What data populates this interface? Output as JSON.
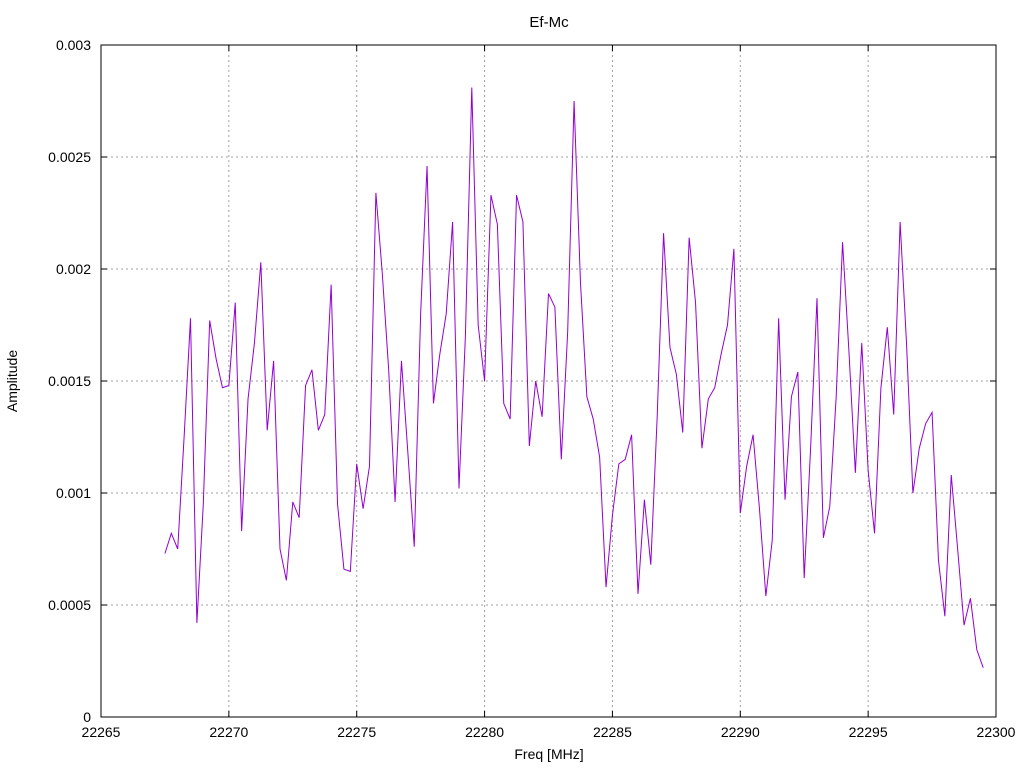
{
  "chart_data": {
    "type": "line",
    "title": "Ef-Mc",
    "xlabel": "Freq [MHz]",
    "ylabel": "Amplitude",
    "xlim": [
      22265,
      22300
    ],
    "ylim": [
      0,
      0.003
    ],
    "xticks": [
      22265,
      22270,
      22275,
      22280,
      22285,
      22290,
      22295,
      22300
    ],
    "yticks": [
      0,
      0.0005,
      0.001,
      0.0015,
      0.002,
      0.0025,
      0.003
    ],
    "ytick_labels": [
      "0",
      "0.0005",
      "0.001",
      "0.0015",
      "0.002",
      "0.0025",
      "0.003"
    ],
    "grid": true,
    "legend": "none",
    "series_color": "#9400d3",
    "x": [
      22267.5,
      22267.75,
      22268.0,
      22268.25,
      22268.5,
      22268.75,
      22269.0,
      22269.25,
      22269.5,
      22269.75,
      22270.0,
      22270.25,
      22270.5,
      22270.75,
      22271.0,
      22271.25,
      22271.5,
      22271.75,
      22272.0,
      22272.25,
      22272.5,
      22272.75,
      22273.0,
      22273.25,
      22273.5,
      22273.75,
      22274.0,
      22274.25,
      22274.5,
      22274.75,
      22275.0,
      22275.25,
      22275.5,
      22275.75,
      22276.0,
      22276.25,
      22276.5,
      22276.75,
      22277.0,
      22277.25,
      22277.5,
      22277.75,
      22278.0,
      22278.25,
      22278.5,
      22278.75,
      22279.0,
      22279.25,
      22279.5,
      22279.75,
      22280.0,
      22280.25,
      22280.5,
      22280.75,
      22281.0,
      22281.25,
      22281.5,
      22281.75,
      22282.0,
      22282.25,
      22282.5,
      22282.75,
      22283.0,
      22283.25,
      22283.5,
      22283.75,
      22284.0,
      22284.25,
      22284.5,
      22284.75,
      22285.0,
      22285.25,
      22285.5,
      22285.75,
      22286.0,
      22286.25,
      22286.5,
      22286.75,
      22287.0,
      22287.25,
      22287.5,
      22287.75,
      22288.0,
      22288.25,
      22288.5,
      22288.75,
      22289.0,
      22289.25,
      22289.5,
      22289.75,
      22290.0,
      22290.25,
      22290.5,
      22290.75,
      22291.0,
      22291.25,
      22291.5,
      22291.75,
      22292.0,
      22292.25,
      22292.5,
      22292.75,
      22293.0,
      22293.25,
      22293.5,
      22293.75,
      22294.0,
      22294.25,
      22294.5,
      22294.75,
      22295.0,
      22295.25,
      22295.5,
      22295.75,
      22296.0,
      22296.25,
      22296.5,
      22296.75,
      22297.0,
      22297.25,
      22297.5,
      22297.75,
      22298.0,
      22298.25,
      22298.5,
      22298.75,
      22299.0,
      22299.25,
      22299.5
    ],
    "y": [
      0.00073,
      0.00082,
      0.00075,
      0.00125,
      0.00178,
      0.00042,
      0.00095,
      0.00177,
      0.0016,
      0.00147,
      0.00148,
      0.00185,
      0.00083,
      0.00142,
      0.00167,
      0.00203,
      0.00128,
      0.00159,
      0.00075,
      0.00061,
      0.00096,
      0.00089,
      0.00148,
      0.00155,
      0.00128,
      0.00135,
      0.00193,
      0.00095,
      0.00066,
      0.00065,
      0.00113,
      0.00093,
      0.00112,
      0.00234,
      0.00198,
      0.00155,
      0.00096,
      0.00159,
      0.00118,
      0.00076,
      0.0018,
      0.00246,
      0.0014,
      0.00162,
      0.0018,
      0.00221,
      0.00102,
      0.0017,
      0.00281,
      0.00175,
      0.0015,
      0.00233,
      0.0022,
      0.0014,
      0.00133,
      0.00233,
      0.00221,
      0.00121,
      0.0015,
      0.00134,
      0.00189,
      0.00183,
      0.00115,
      0.00172,
      0.00275,
      0.00194,
      0.00143,
      0.00133,
      0.00116,
      0.00058,
      0.0009,
      0.00113,
      0.00115,
      0.00126,
      0.00055,
      0.00097,
      0.00068,
      0.00134,
      0.00216,
      0.00165,
      0.00153,
      0.00127,
      0.00214,
      0.00185,
      0.0012,
      0.00142,
      0.00147,
      0.00162,
      0.00175,
      0.00209,
      0.00091,
      0.00112,
      0.00126,
      0.00093,
      0.00054,
      0.00079,
      0.00178,
      0.00097,
      0.00143,
      0.00154,
      0.00062,
      0.0012,
      0.00187,
      0.0008,
      0.00094,
      0.00143,
      0.00212,
      0.00163,
      0.00109,
      0.00167,
      0.0011,
      0.00082,
      0.00147,
      0.00174,
      0.00135,
      0.00221,
      0.00167,
      0.001,
      0.0012,
      0.00131,
      0.00136,
      0.0007,
      0.00045,
      0.00108,
      0.00075,
      0.00041,
      0.00053,
      0.0003,
      0.00022
    ]
  }
}
